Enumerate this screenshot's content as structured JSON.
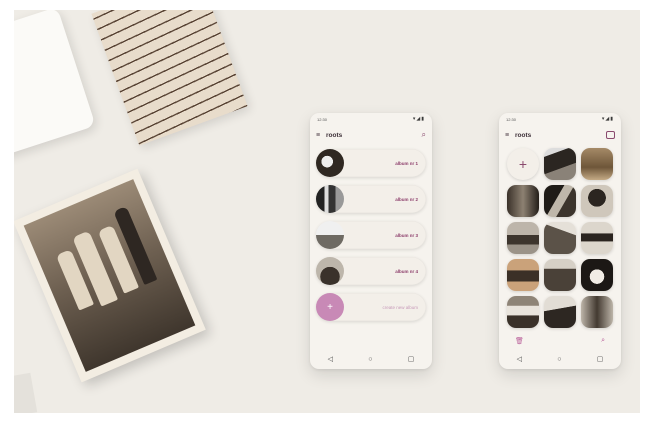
{
  "phone_albums": {
    "status": {
      "time": "12:30",
      "icons": "▾◢▮"
    },
    "appbar": {
      "title": "roots"
    },
    "albums": [
      {
        "label": "album nr 1"
      },
      {
        "label": "album nr 2"
      },
      {
        "label": "album nr 3"
      },
      {
        "label": "album nr 4"
      }
    ],
    "add_album": {
      "plus": "+",
      "label": "create new album"
    },
    "nav": {
      "back": "◁",
      "home": "○",
      "recents": "▢"
    }
  },
  "phone_grid": {
    "status": {
      "time": "12:30",
      "icons": "▾◢▮"
    },
    "appbar": {
      "title": "roots"
    },
    "add_photo": "+",
    "photo_count": 14,
    "bottombar": {
      "delete_icon": "trash-icon",
      "search_icon": "search-icon"
    },
    "nav": {
      "back": "◁",
      "home": "○",
      "recents": "▢"
    }
  },
  "colors": {
    "accent": "#8c3d6a",
    "accent_light": "#c889b6",
    "background": "#efece6"
  }
}
